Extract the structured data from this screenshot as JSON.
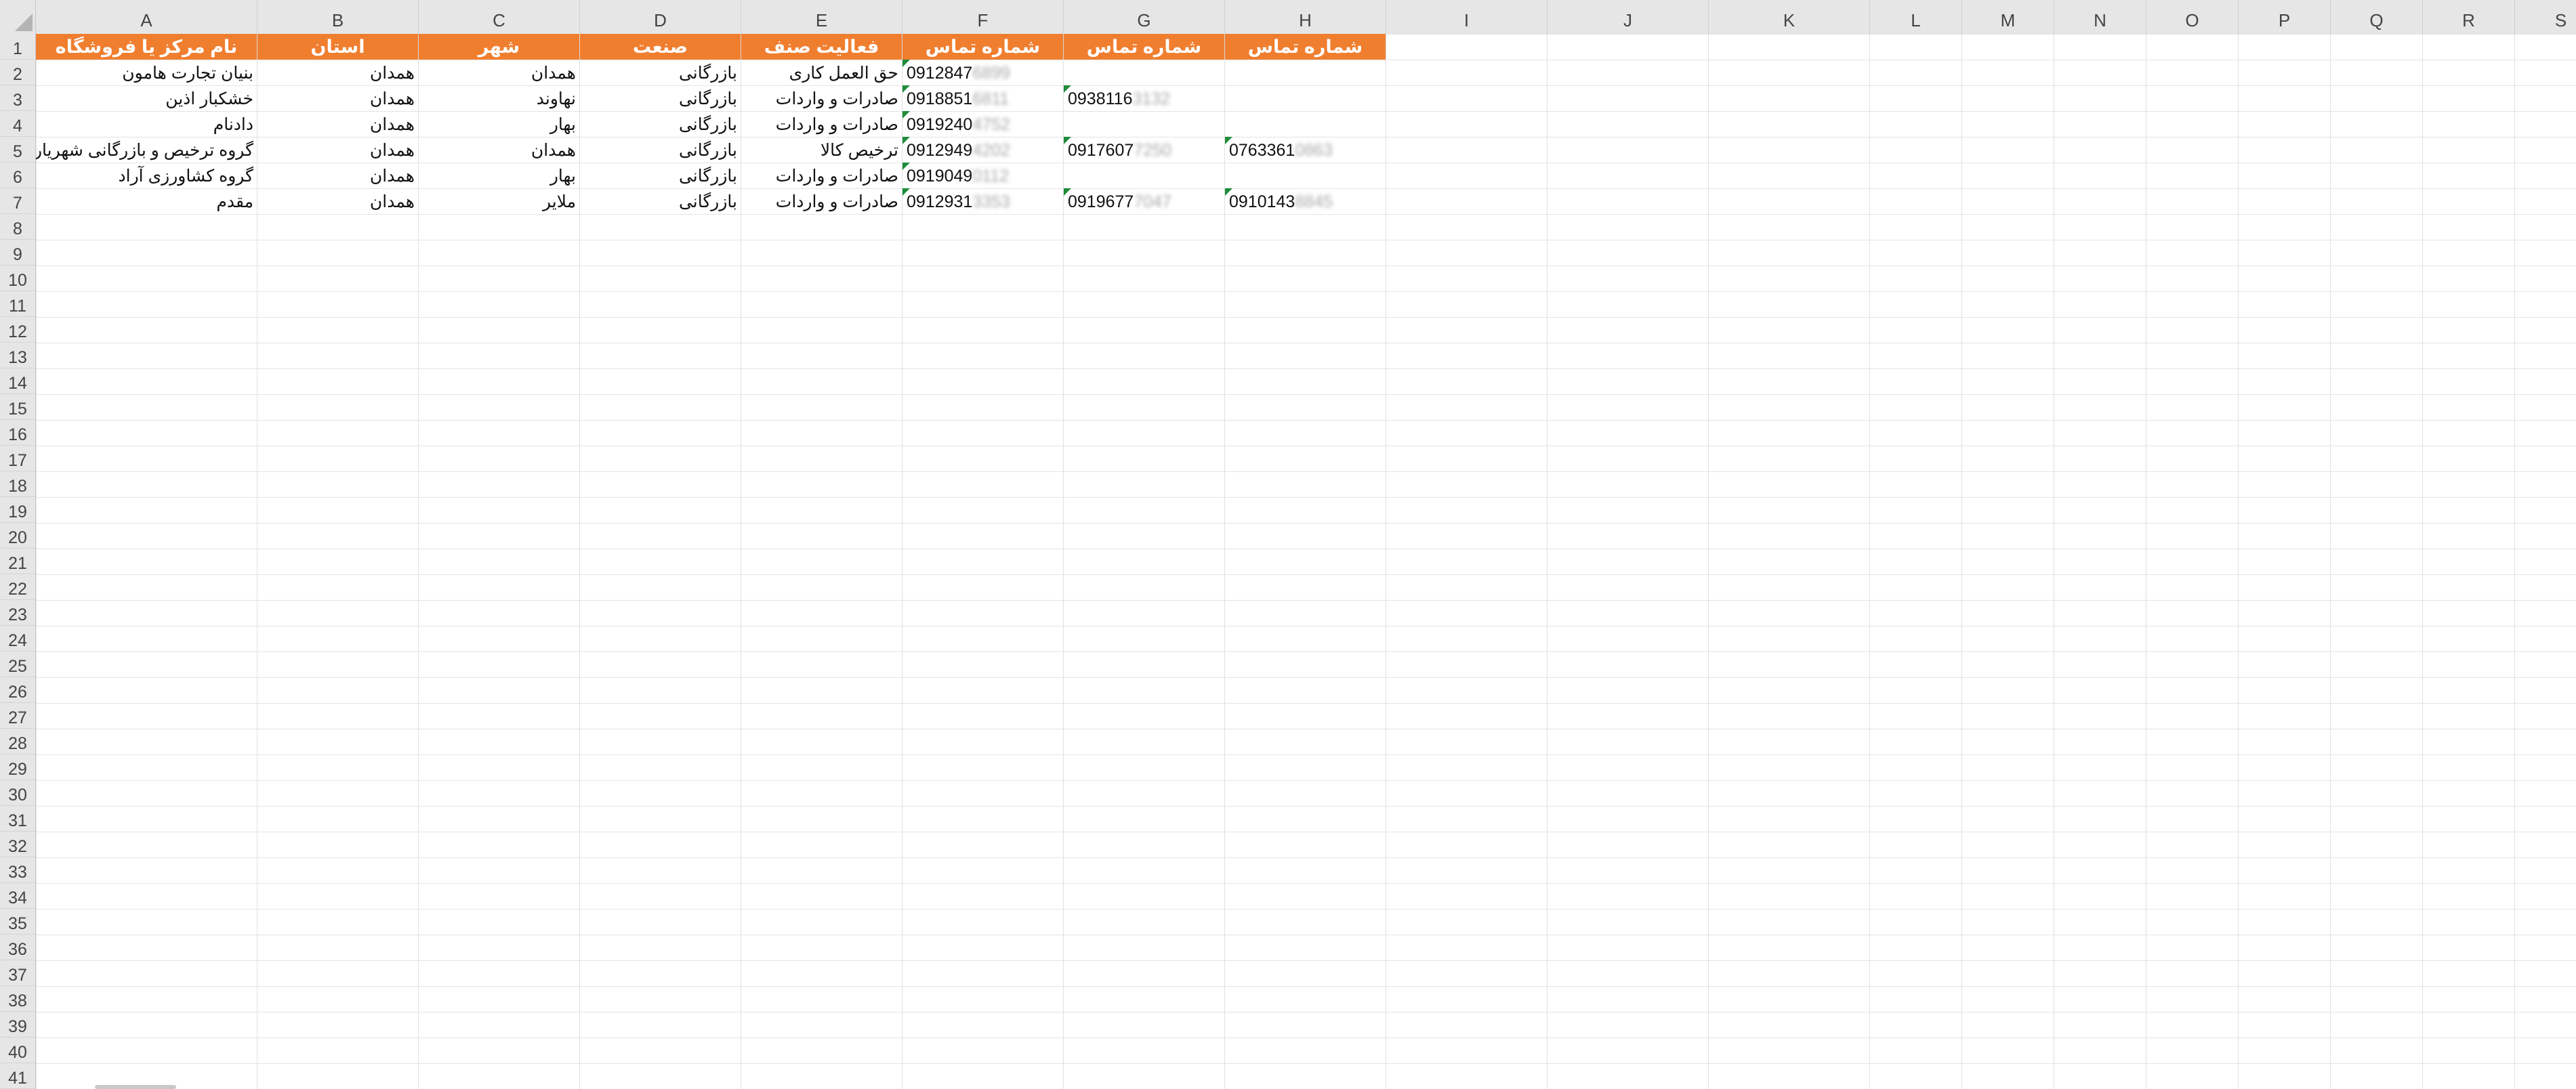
{
  "sheet": {
    "columns": [
      "A",
      "B",
      "C",
      "D",
      "E",
      "F",
      "G",
      "H",
      "I",
      "J",
      "K",
      "L",
      "M",
      "N",
      "O",
      "P",
      "Q",
      "R",
      "S"
    ],
    "row_numbers": [
      "1",
      "2",
      "3",
      "4",
      "5",
      "6",
      "7",
      "8",
      "9",
      "10",
      "11",
      "12",
      "13",
      "14",
      "15",
      "16",
      "17",
      "18",
      "19",
      "20",
      "21",
      "22",
      "23",
      "24",
      "25",
      "26",
      "27",
      "28",
      "29",
      "30",
      "31",
      "32",
      "33",
      "34",
      "35",
      "36",
      "37",
      "38",
      "39",
      "40",
      "41"
    ],
    "header_row": [
      "نام مرکز یا فروشگاه",
      "استان",
      "شهر",
      "صنعت",
      "فعالیت صنف",
      "شماره تماس",
      "شماره تماس",
      "شماره تماس"
    ],
    "header_color": "#f07e2f",
    "flag_color": "#1e8c3a",
    "rows": [
      {
        "name": "بنیان تجارت هامون",
        "province": "همدان",
        "city": "همدان",
        "industry": "بازرگانی",
        "activity": "حق العمل کاری",
        "phone1": {
          "visible": "0912847",
          "masked": "6899"
        },
        "phone2": {
          "visible": "",
          "masked": ""
        },
        "phone3": {
          "visible": "",
          "masked": ""
        }
      },
      {
        "name": "خشکبار اذین",
        "province": "همدان",
        "city": "نهاوند",
        "industry": "بازرگانی",
        "activity": "صادرات و واردات",
        "phone1": {
          "visible": "0918851",
          "masked": "6811"
        },
        "phone2": {
          "visible": "0938116",
          "masked": "3132"
        },
        "phone3": {
          "visible": "",
          "masked": ""
        }
      },
      {
        "name": "دادنام",
        "province": "همدان",
        "city": "بهار",
        "industry": "بازرگانی",
        "activity": "صادرات و واردات",
        "phone1": {
          "visible": "0919240",
          "masked": "4752"
        },
        "phone2": {
          "visible": "",
          "masked": ""
        },
        "phone3": {
          "visible": "",
          "masked": ""
        }
      },
      {
        "name": "گروه ترخیص و بازرگانی شهریاری",
        "province": "همدان",
        "city": "همدان",
        "industry": "بازرگانی",
        "activity": "ترخیص کالا",
        "phone1": {
          "visible": "0912949",
          "masked": "4202"
        },
        "phone2": {
          "visible": "0917607",
          "masked": "7250"
        },
        "phone3": {
          "visible": "0763361",
          "masked": "0863"
        }
      },
      {
        "name": "گروه کشاورزی آراد",
        "province": "همدان",
        "city": "بهار",
        "industry": "بازرگانی",
        "activity": "صادرات و واردات",
        "phone1": {
          "visible": "0919049",
          "masked": "0112"
        },
        "phone2": {
          "visible": "",
          "masked": ""
        },
        "phone3": {
          "visible": "",
          "masked": ""
        }
      },
      {
        "name": "مقدم",
        "province": "همدان",
        "city": "ملایر",
        "industry": "بازرگانی",
        "activity": "صادرات و واردات",
        "phone1": {
          "visible": "0912931",
          "masked": "3353"
        },
        "phone2": {
          "visible": "0919677",
          "masked": "7047"
        },
        "phone3": {
          "visible": "0910143",
          "masked": "8845"
        }
      }
    ]
  }
}
